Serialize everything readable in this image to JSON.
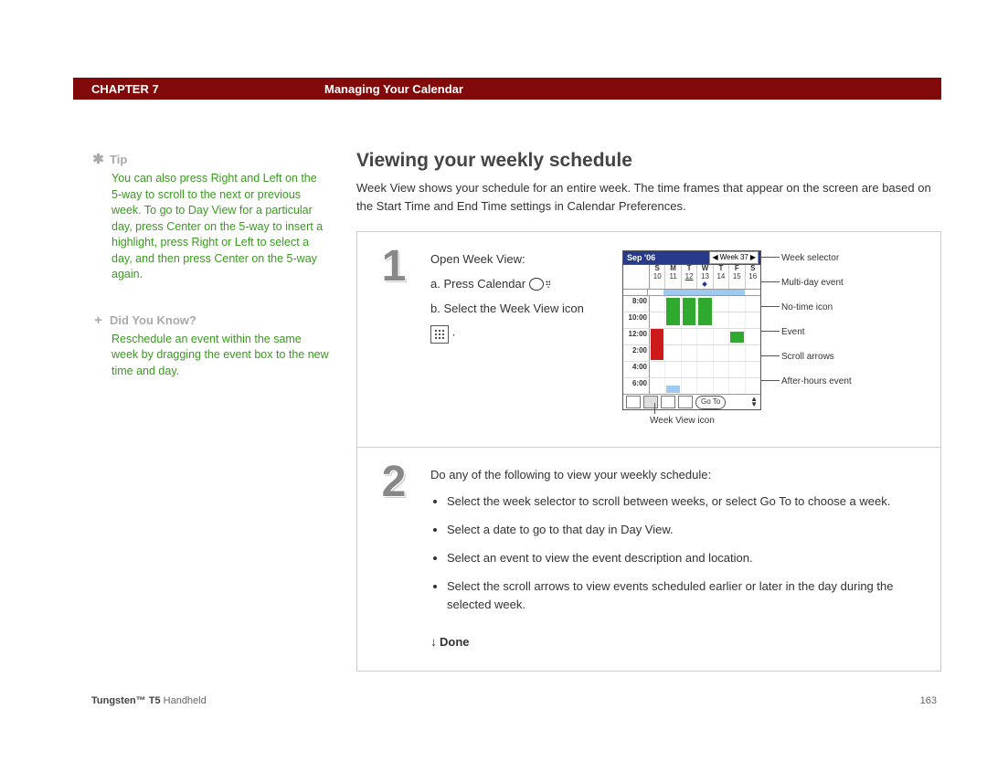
{
  "header": {
    "chapter": "CHAPTER 7",
    "section": "Managing Your Calendar"
  },
  "sidebar": {
    "tip": {
      "title": "Tip",
      "text": "You can also press Right and Left on the 5-way to scroll to the next or previous week. To go to Day View for a particular day, press Center on the 5-way to insert a highlight, press Right or Left to select a day, and then press Center on the 5-way again."
    },
    "didyouknow": {
      "title": "Did You Know?",
      "text": "Reschedule an event within the same week by dragging the event box to the new time and day."
    }
  },
  "main": {
    "title": "Viewing your weekly schedule",
    "intro": "Week View shows your schedule for an entire week. The time frames that appear on the screen are based on the Start Time and End Time settings in Calendar Preferences.",
    "step1": {
      "num": "1",
      "lead": "Open Week View:",
      "a": "a.  Press Calendar",
      "b": "b.  Select the Week View icon"
    },
    "step2": {
      "num": "2",
      "lead": "Do any of the following to view your weekly schedule:",
      "bullets": [
        "Select the week selector to scroll between weeks, or select Go To to choose a week.",
        "Select a date to go to that day in Day View.",
        "Select an event to view the event description and location.",
        "Select the scroll arrows to view events scheduled earlier or later in the day during the selected week."
      ],
      "done": "Done"
    }
  },
  "calendar": {
    "month": "Sep '06",
    "week_label": "Week",
    "week_num": "37",
    "days_letters": [
      "S",
      "M",
      "T",
      "W",
      "T",
      "F",
      "S"
    ],
    "days_nums": [
      "10",
      "11",
      "12",
      "13",
      "14",
      "15",
      "16"
    ],
    "times": [
      "8:00",
      "10:00",
      "12:00",
      "2:00",
      "4:00",
      "6:00"
    ],
    "goto": "Go To"
  },
  "callouts": {
    "week_selector": "Week selector",
    "multiday": "Multi-day event",
    "notime": "No-time icon",
    "event": "Event",
    "scroll": "Scroll arrows",
    "afterhours": "After-hours event",
    "weekview": "Week View icon"
  },
  "footer": {
    "product_bold": "Tungsten™ T5",
    "product_rest": " Handheld",
    "page": "163"
  }
}
